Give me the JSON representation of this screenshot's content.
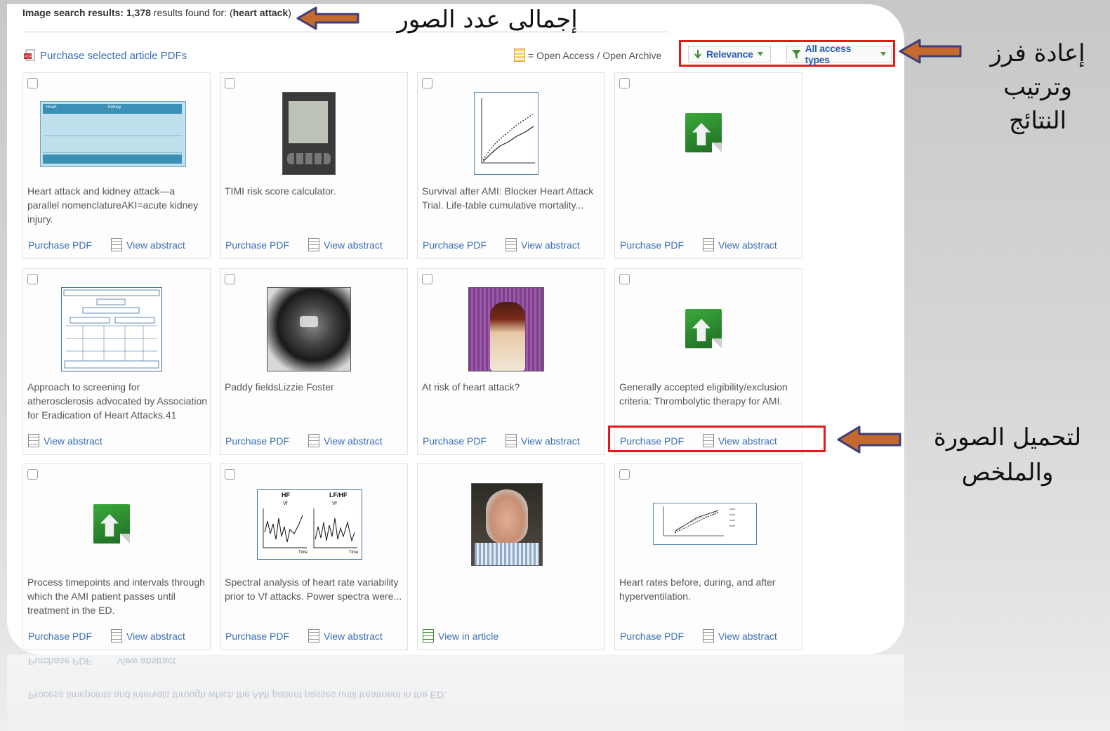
{
  "results": {
    "prefix": "Image search results:",
    "count": "1,378",
    "suffix": "results found for: (",
    "query": "heart attack",
    "close": ")"
  },
  "toolbar": {
    "purchase_selected": "Purchase selected article PDFs",
    "open_access_legend": "= Open Access / Open Archive",
    "sort_label": "Relevance",
    "filter_label": "All access types"
  },
  "cards": [
    {
      "caption": "Heart attack and kidney attack—a parallel nomenclatureAKI=acute kidney injury.",
      "purchase": "Purchase PDF",
      "abstract": "View abstract"
    },
    {
      "caption": "TIMI risk score calculator.",
      "purchase": "Purchase PDF",
      "abstract": "View abstract"
    },
    {
      "caption": "Survival after AMI: Blocker Heart Attack Trial. Life-table cumulative mortality...",
      "purchase": "Purchase PDF",
      "abstract": "View abstract"
    },
    {
      "caption": "",
      "purchase": "Purchase PDF",
      "abstract": "View abstract"
    },
    {
      "caption": "Approach to screening for atherosclerosis advocated by Association for Eradication of Heart Attacks.41",
      "purchase": "",
      "abstract": "View abstract"
    },
    {
      "caption": "Paddy fieldsLizzie Foster",
      "purchase": "Purchase PDF",
      "abstract": "View abstract"
    },
    {
      "caption": "At risk of heart attack?",
      "purchase": "Purchase PDF",
      "abstract": "View abstract"
    },
    {
      "caption": "Generally accepted eligibility/exclusion criteria: Thrombolytic therapy for AMI.",
      "purchase": "Purchase PDF",
      "abstract": "View abstract"
    },
    {
      "caption": "Process timepoints and intervals through which the AMI patient passes until treatment in the ED.",
      "purchase": "Purchase PDF",
      "abstract": "View abstract"
    },
    {
      "caption": "Spectral analysis of heart rate variability prior to Vf attacks. Power spectra were...",
      "purchase": "Purchase PDF",
      "abstract": "View abstract"
    },
    {
      "caption": "",
      "purchase": "",
      "abstract": "View in article"
    },
    {
      "caption": "Heart rates before, during, and after hyperventilation.",
      "purchase": "Purchase PDF",
      "abstract": "View abstract"
    }
  ],
  "thumb_text": {
    "hf": "HF",
    "lfhf": "LF/HF",
    "vf": "Vf",
    "time": "Time",
    "table_rows": [
      "Heart",
      "Kidney"
    ]
  },
  "annotations": {
    "total_images": "إجمالى عدد الصور",
    "reorder": "إعادة فرز وترتيب النتائج",
    "download": "لتحميل الصورة والملخص"
  },
  "colors": {
    "link": "#3a6fb3",
    "highlight": "#e81818",
    "arrow_fill": "#c46a2c",
    "arrow_outline": "#3a3f7a",
    "oa_icon": "#f6cf6f"
  }
}
